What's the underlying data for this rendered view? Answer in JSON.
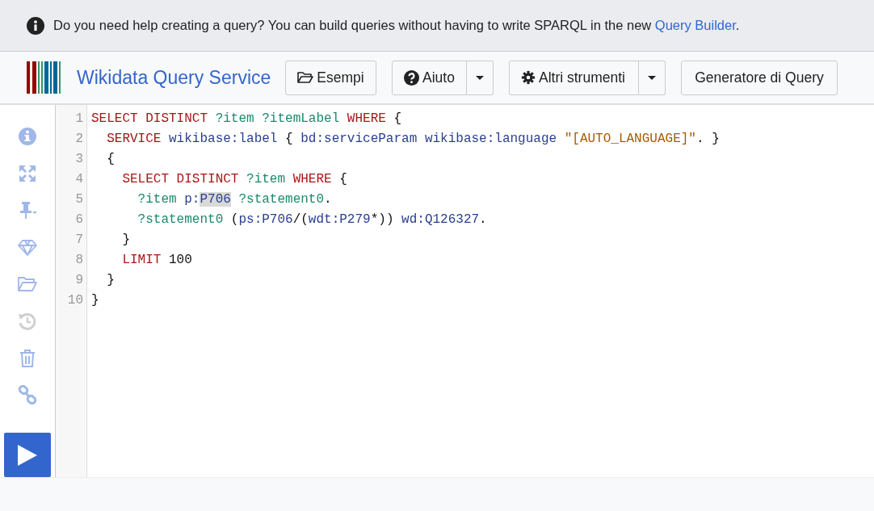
{
  "banner": {
    "text": "Do you need help creating a query? You can build queries without having to write SPARQL in the new ",
    "link": "Query Builder",
    "end": "."
  },
  "header": {
    "title": "Wikidata Query Service",
    "buttons": [
      {
        "label": "Esempi",
        "kind": "folder",
        "dropdown": false
      },
      {
        "label": "Aiuto",
        "kind": "question",
        "dropdown": true
      },
      {
        "label": "Altri strumenti",
        "kind": "gear",
        "dropdown": true
      },
      {
        "label": "Generatore di Query",
        "kind": "plain",
        "dropdown": false
      }
    ]
  },
  "sidebar": {
    "items": [
      {
        "kind": "info",
        "disabled": false
      },
      {
        "kind": "expand",
        "disabled": false
      },
      {
        "kind": "pin",
        "disabled": false
      },
      {
        "kind": "gem",
        "disabled": false
      },
      {
        "kind": "folder",
        "disabled": false
      },
      {
        "kind": "history",
        "disabled": true
      },
      {
        "kind": "trash",
        "disabled": false
      },
      {
        "kind": "link",
        "disabled": false
      }
    ],
    "run": {
      "kind": "play"
    }
  },
  "editor": {
    "lines": [
      {
        "number": "1",
        "tokens": [
          {
            "kind": "kw",
            "text": "SELECT DISTINCT "
          },
          {
            "kind": "var",
            "text": "?item ?itemLabel "
          },
          {
            "kind": "kw",
            "text": "WHERE "
          },
          {
            "kind": "punct",
            "text": "{"
          }
        ]
      },
      {
        "number": "2",
        "tokens": [
          {
            "kind": "kw",
            "text": "  SERVICE "
          },
          {
            "kind": "iri",
            "text": "wikibase:label "
          },
          {
            "kind": "punct",
            "text": "{ "
          },
          {
            "kind": "iri",
            "text": "bd:serviceParam wikibase:language "
          },
          {
            "kind": "str",
            "text": "\"[AUTO_LANGUAGE]\""
          },
          {
            "kind": "punct",
            "text": ". }"
          }
        ]
      },
      {
        "number": "3",
        "tokens": [
          {
            "kind": "punct",
            "text": "  {"
          }
        ]
      },
      {
        "number": "4",
        "tokens": [
          {
            "kind": "kw",
            "text": "    SELECT DISTINCT "
          },
          {
            "kind": "var",
            "text": "?item "
          },
          {
            "kind": "kw",
            "text": "WHERE "
          },
          {
            "kind": "punct",
            "text": "{"
          }
        ]
      },
      {
        "number": "5",
        "tokens": [
          {
            "kind": "var",
            "text": "      ?item "
          },
          {
            "kind": "iri",
            "text": "p:"
          },
          {
            "kind": "match",
            "text": "P706"
          },
          {
            "kind": "var",
            "text": " ?statement0"
          },
          {
            "kind": "punct",
            "text": "."
          }
        ]
      },
      {
        "number": "6",
        "tokens": [
          {
            "kind": "var",
            "text": "      ?statement0 "
          },
          {
            "kind": "punct",
            "text": "("
          },
          {
            "kind": "iri",
            "text": "ps:P706"
          },
          {
            "kind": "punct",
            "text": "/("
          },
          {
            "kind": "iri",
            "text": "wdt:P279"
          },
          {
            "kind": "punct",
            "text": "*)) "
          },
          {
            "kind": "iri",
            "text": "wd:Q126327"
          },
          {
            "kind": "punct",
            "text": "."
          }
        ]
      },
      {
        "number": "7",
        "tokens": [
          {
            "kind": "punct",
            "text": "    }"
          }
        ]
      },
      {
        "number": "8",
        "tokens": [
          {
            "kind": "kw",
            "text": "    LIMIT "
          },
          {
            "kind": "num",
            "text": "100"
          }
        ]
      },
      {
        "number": "9",
        "tokens": [
          {
            "kind": "punct",
            "text": "  }"
          }
        ]
      },
      {
        "number": "10",
        "tokens": [
          {
            "kind": "punct",
            "text": "}"
          }
        ]
      }
    ]
  }
}
